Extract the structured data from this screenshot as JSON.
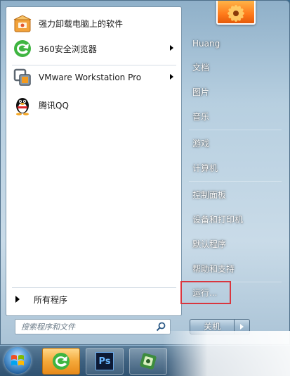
{
  "programs": [
    {
      "label": "强力卸载电脑上的软件",
      "icon": "uninstall-box-icon",
      "has_submenu": false
    },
    {
      "label": "360安全浏览器",
      "icon": "360-browser-icon",
      "has_submenu": true
    },
    {
      "label": "VMware Workstation Pro",
      "icon": "vmware-icon",
      "has_submenu": true
    },
    {
      "label": "腾讯QQ",
      "icon": "qq-penguin-icon",
      "has_submenu": false
    }
  ],
  "all_programs_label": "所有程序",
  "search": {
    "placeholder": "搜索程序和文件"
  },
  "right_menu": {
    "user": "Huang",
    "documents": "文档",
    "pictures": "图片",
    "music": "音乐",
    "games": "游戏",
    "computer": "计算机",
    "control_panel": "控制面板",
    "devices_printers": "设备和打印机",
    "default_programs": "默认程序",
    "help_support": "帮助和支持",
    "run": "运行..."
  },
  "shutdown_label": "关机",
  "taskbar": {
    "items": [
      "start-orb",
      "360-browser",
      "photoshop",
      "gadget-app"
    ],
    "photoshop_label": "Ps"
  },
  "colors": {
    "highlight_red": "#d9363e",
    "accent_orange": "#f4a93a"
  }
}
